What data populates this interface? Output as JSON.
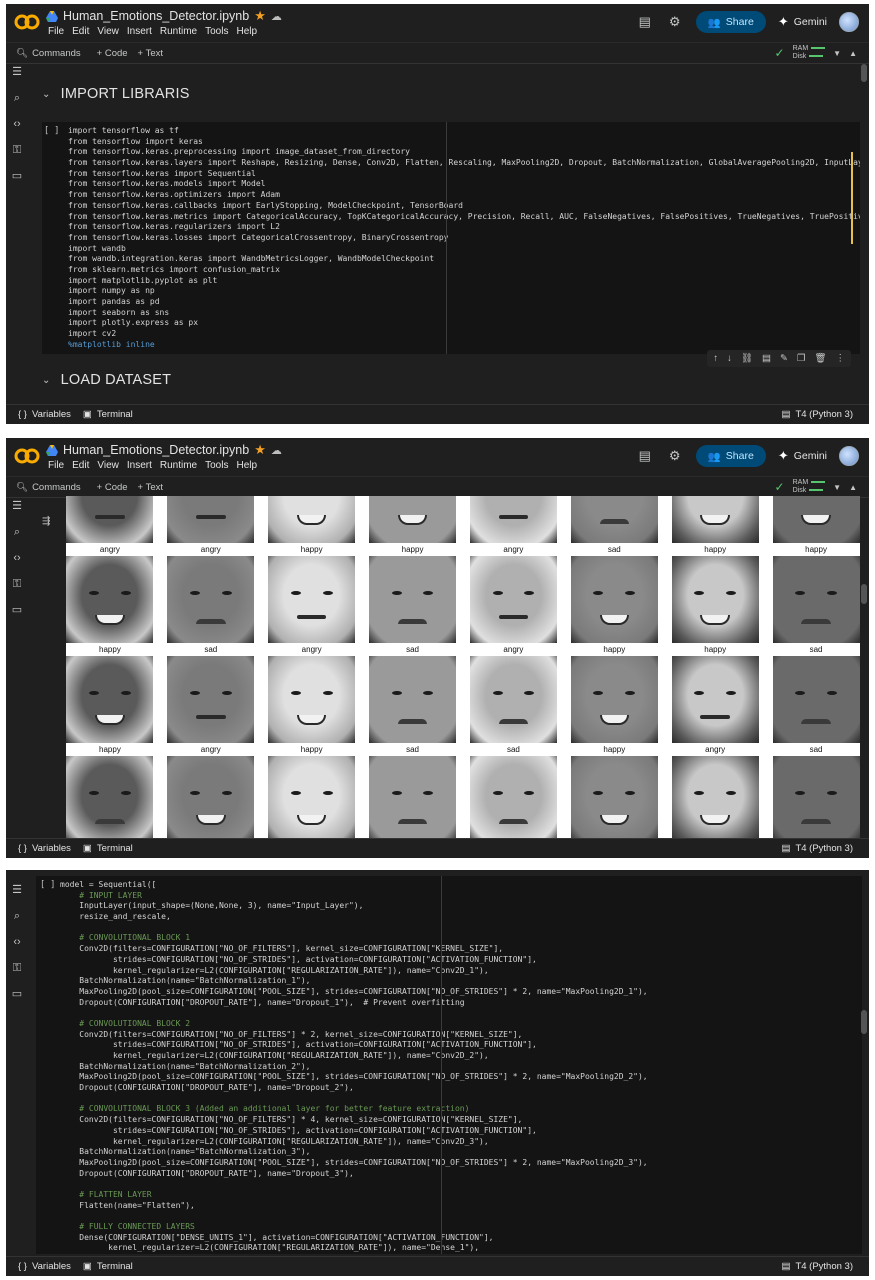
{
  "app": {
    "notebook_title": "Human_Emotions_Detector.ipynb",
    "menu": [
      "File",
      "Edit",
      "View",
      "Insert",
      "Runtime",
      "Tools",
      "Help"
    ],
    "share_label": "Share",
    "gemini_label": "Gemini",
    "toolbar": {
      "commands": "Commands",
      "code": "+ Code",
      "text": "+ Text",
      "ram": "RAM",
      "disk": "Disk"
    },
    "footer": {
      "variables": "Variables",
      "terminal": "Terminal",
      "runtime": "T4 (Python 3)"
    },
    "brand_color": "#f9ab00"
  },
  "panel1": {
    "section_import": "IMPORT LIBRARIS",
    "section_load": "LOAD DATASET",
    "cell_bracket": "[ ]",
    "code": [
      "import tensorflow as tf",
      "from tensorflow import keras",
      "from tensorflow.keras.preprocessing import image_dataset_from_directory",
      "from tensorflow.keras.layers import Reshape, Resizing, Dense, Conv2D, Flatten, Rescaling, MaxPooling2D, Dropout, BatchNormalization, GlobalAveragePooling2D, InputLaye",
      "from tensorflow.keras import Sequential",
      "from tensorflow.keras.models import Model",
      "from tensorflow.keras.optimizers import Adam",
      "from tensorflow.keras.callbacks import EarlyStopping, ModelCheckpoint, TensorBoard",
      "from tensorflow.keras.metrics import CategoricalAccuracy, TopKCategoricalAccuracy, Precision, Recall, AUC, FalseNegatives, FalsePositives, TrueNegatives, TruePositive",
      "from tensorflow.keras.regularizers import L2",
      "from tensorflow.keras.losses import CategoricalCrossentropy, BinaryCrossentropy",
      "import wandb",
      "from wandb.integration.keras import WandbMetricsLogger, WandbModelCheckpoint",
      "from sklearn.metrics import confusion_matrix",
      "import matplotlib.pyplot as plt",
      "import numpy as np",
      "import pandas as pd",
      "import seaborn as sns",
      "import plotly.express as px",
      "import cv2",
      "%matplotlib inline"
    ]
  },
  "panel2": {
    "labels": [
      "angry",
      "angry",
      "happy",
      "happy",
      "angry",
      "sad",
      "happy",
      "happy",
      "happy",
      "sad",
      "angry",
      "sad",
      "angry",
      "happy",
      "happy",
      "sad",
      "happy",
      "angry",
      "happy",
      "sad",
      "sad",
      "happy",
      "angry",
      "sad",
      "",
      "",
      "",
      "",
      "",
      "",
      "",
      ""
    ]
  },
  "panel3": {
    "cell_bracket": "[ ]",
    "code": [
      "model = Sequential([",
      "    # INPUT LAYER",
      "    InputLayer(input_shape=(None,None, 3), name=\"Input_Layer\"),",
      "    resize_and_rescale,",
      "",
      "    # CONVOLUTIONAL BLOCK 1",
      "    Conv2D(filters=CONFIGURATION[\"NO_OF_FILTERS\"], kernel_size=CONFIGURATION[\"KERNEL_SIZE\"],",
      "           strides=CONFIGURATION[\"NO_OF_STRIDES\"], activation=CONFIGURATION[\"ACTIVATION_FUNCTION\"],",
      "           kernel_regularizer=L2(CONFIGURATION[\"REGULARIZATION_RATE\"]), name=\"Conv2D_1\"),",
      "    BatchNormalization(name=\"BatchNormalization_1\"),",
      "    MaxPooling2D(pool_size=CONFIGURATION[\"POOL_SIZE\"], strides=CONFIGURATION[\"NO_OF_STRIDES\"] * 2, name=\"MaxPooling2D_1\"),",
      "    Dropout(CONFIGURATION[\"DROPOUT_RATE\"], name=\"Dropout_1\"),  # Prevent overfitting",
      "",
      "    # CONVOLUTIONAL BLOCK 2",
      "    Conv2D(filters=CONFIGURATION[\"NO_OF_FILTERS\"] * 2, kernel_size=CONFIGURATION[\"KERNEL_SIZE\"],",
      "           strides=CONFIGURATION[\"NO_OF_STRIDES\"], activation=CONFIGURATION[\"ACTIVATION_FUNCTION\"],",
      "           kernel_regularizer=L2(CONFIGURATION[\"REGULARIZATION_RATE\"]), name=\"Conv2D_2\"),",
      "    BatchNormalization(name=\"BatchNormalization_2\"),",
      "    MaxPooling2D(pool_size=CONFIGURATION[\"POOL_SIZE\"], strides=CONFIGURATION[\"NO_OF_STRIDES\"] * 2, name=\"MaxPooling2D_2\"),",
      "    Dropout(CONFIGURATION[\"DROPOUT_RATE\"], name=\"Dropout_2\"),",
      "",
      "    # CONVOLUTIONAL BLOCK 3 (Added an additional layer for better feature extraction)",
      "    Conv2D(filters=CONFIGURATION[\"NO_OF_FILTERS\"] * 4, kernel_size=CONFIGURATION[\"KERNEL_SIZE\"],",
      "           strides=CONFIGURATION[\"NO_OF_STRIDES\"], activation=CONFIGURATION[\"ACTIVATION_FUNCTION\"],",
      "           kernel_regularizer=L2(CONFIGURATION[\"REGULARIZATION_RATE\"]), name=\"Conv2D_3\"),",
      "    BatchNormalization(name=\"BatchNormalization_3\"),",
      "    MaxPooling2D(pool_size=CONFIGURATION[\"POOL_SIZE\"], strides=CONFIGURATION[\"NO_OF_STRIDES\"] * 2, name=\"MaxPooling2D_3\"),",
      "    Dropout(CONFIGURATION[\"DROPOUT_RATE\"], name=\"Dropout_3\"),",
      "",
      "    # FLATTEN LAYER",
      "    Flatten(name=\"Flatten\"),",
      "",
      "    # FULLY CONNECTED LAYERS",
      "    Dense(CONFIGURATION[\"DENSE_UNITS_1\"], activation=CONFIGURATION[\"ACTIVATION_FUNCTION\"],",
      "          kernel_regularizer=L2(CONFIGURATION[\"REGULARIZATION_RATE\"]), name=\"Dense_1\"),"
    ]
  }
}
